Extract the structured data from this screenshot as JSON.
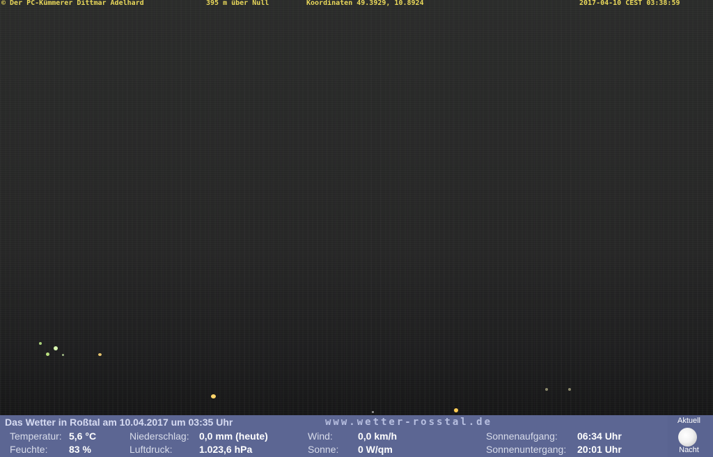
{
  "overlay": {
    "copyright": "© Der PC-Kümmerer Dittmar Adelhard",
    "altitude": "395 m über Null",
    "coords": "Koordinaten 49.3929, 10.8924",
    "timestamp": "2017-04-10 CEST 03:38:59"
  },
  "weather": {
    "headline": "Das Wetter in Roßtal am 10.04.2017 um 03:35 Uhr",
    "website": "www.wetter-rosstal.de",
    "temp_label": "Temperatur:",
    "temp_value": "5,6 °C",
    "humidity_label": "Feuchte:",
    "humidity_value": "83 %",
    "precip_label": "Niederschlag:",
    "precip_value": "0,0 mm (heute)",
    "pressure_label": "Luftdruck:",
    "pressure_value": "1.023,6 hPa",
    "wind_label": "Wind:",
    "wind_value": "0,0 km/h",
    "sun_label": "Sonne:",
    "sun_value": "0 W/qm",
    "sunrise_label": "Sonnenaufgang:",
    "sunrise_value": "06:34 Uhr",
    "sunset_label": "Sonnenuntergang:",
    "sunset_value": "20:01 Uhr"
  },
  "moon": {
    "top_label": "Aktuell",
    "bottom_label": "Nacht",
    "icon": "full-moon-icon"
  }
}
